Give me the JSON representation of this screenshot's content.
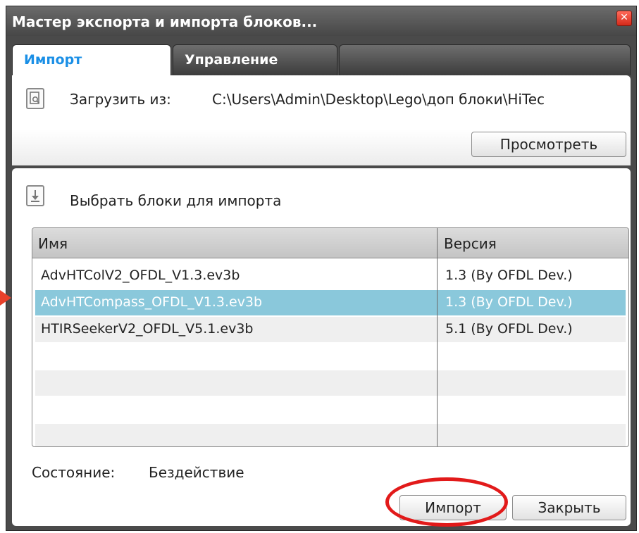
{
  "window": {
    "title": "Мастер экспорта и импорта блоков...",
    "close_glyph": "✕"
  },
  "tabs": [
    {
      "label": "Импорт",
      "active": true
    },
    {
      "label": "Управление",
      "active": false
    }
  ],
  "load": {
    "icon": "document-search-icon",
    "label": "Загрузить из:",
    "path": "C:\\Users\\Admin\\Desktop\\Lego\\доп блоки\\HiTec",
    "browse_label": "Просмотреть"
  },
  "select": {
    "icon": "download-arrow-icon",
    "label": "Выбрать блоки для импорта"
  },
  "table": {
    "columns": [
      "Имя",
      "Версия"
    ],
    "rows": [
      {
        "name": "AdvHTColV2_OFDL_V1.3.ev3b",
        "version": "1.3 (By OFDL Dev.)",
        "selected": false
      },
      {
        "name": "AdvHTCompass_OFDL_V1.3.ev3b",
        "version": "1.3 (By OFDL Dev.)",
        "selected": true
      },
      {
        "name": "HTIRSeekerV2_OFDL_V5.1.ev3b",
        "version": "5.1 (By OFDL Dev.)",
        "selected": false
      }
    ]
  },
  "status": {
    "label": "Состояние:",
    "value": "Бездействие"
  },
  "buttons": {
    "import_label": "Импорт",
    "close_label": "Закрыть"
  },
  "colors": {
    "accent_tab": "#1a8fe6",
    "selection": "#8ac8db",
    "annotation": "#e21a1a"
  }
}
